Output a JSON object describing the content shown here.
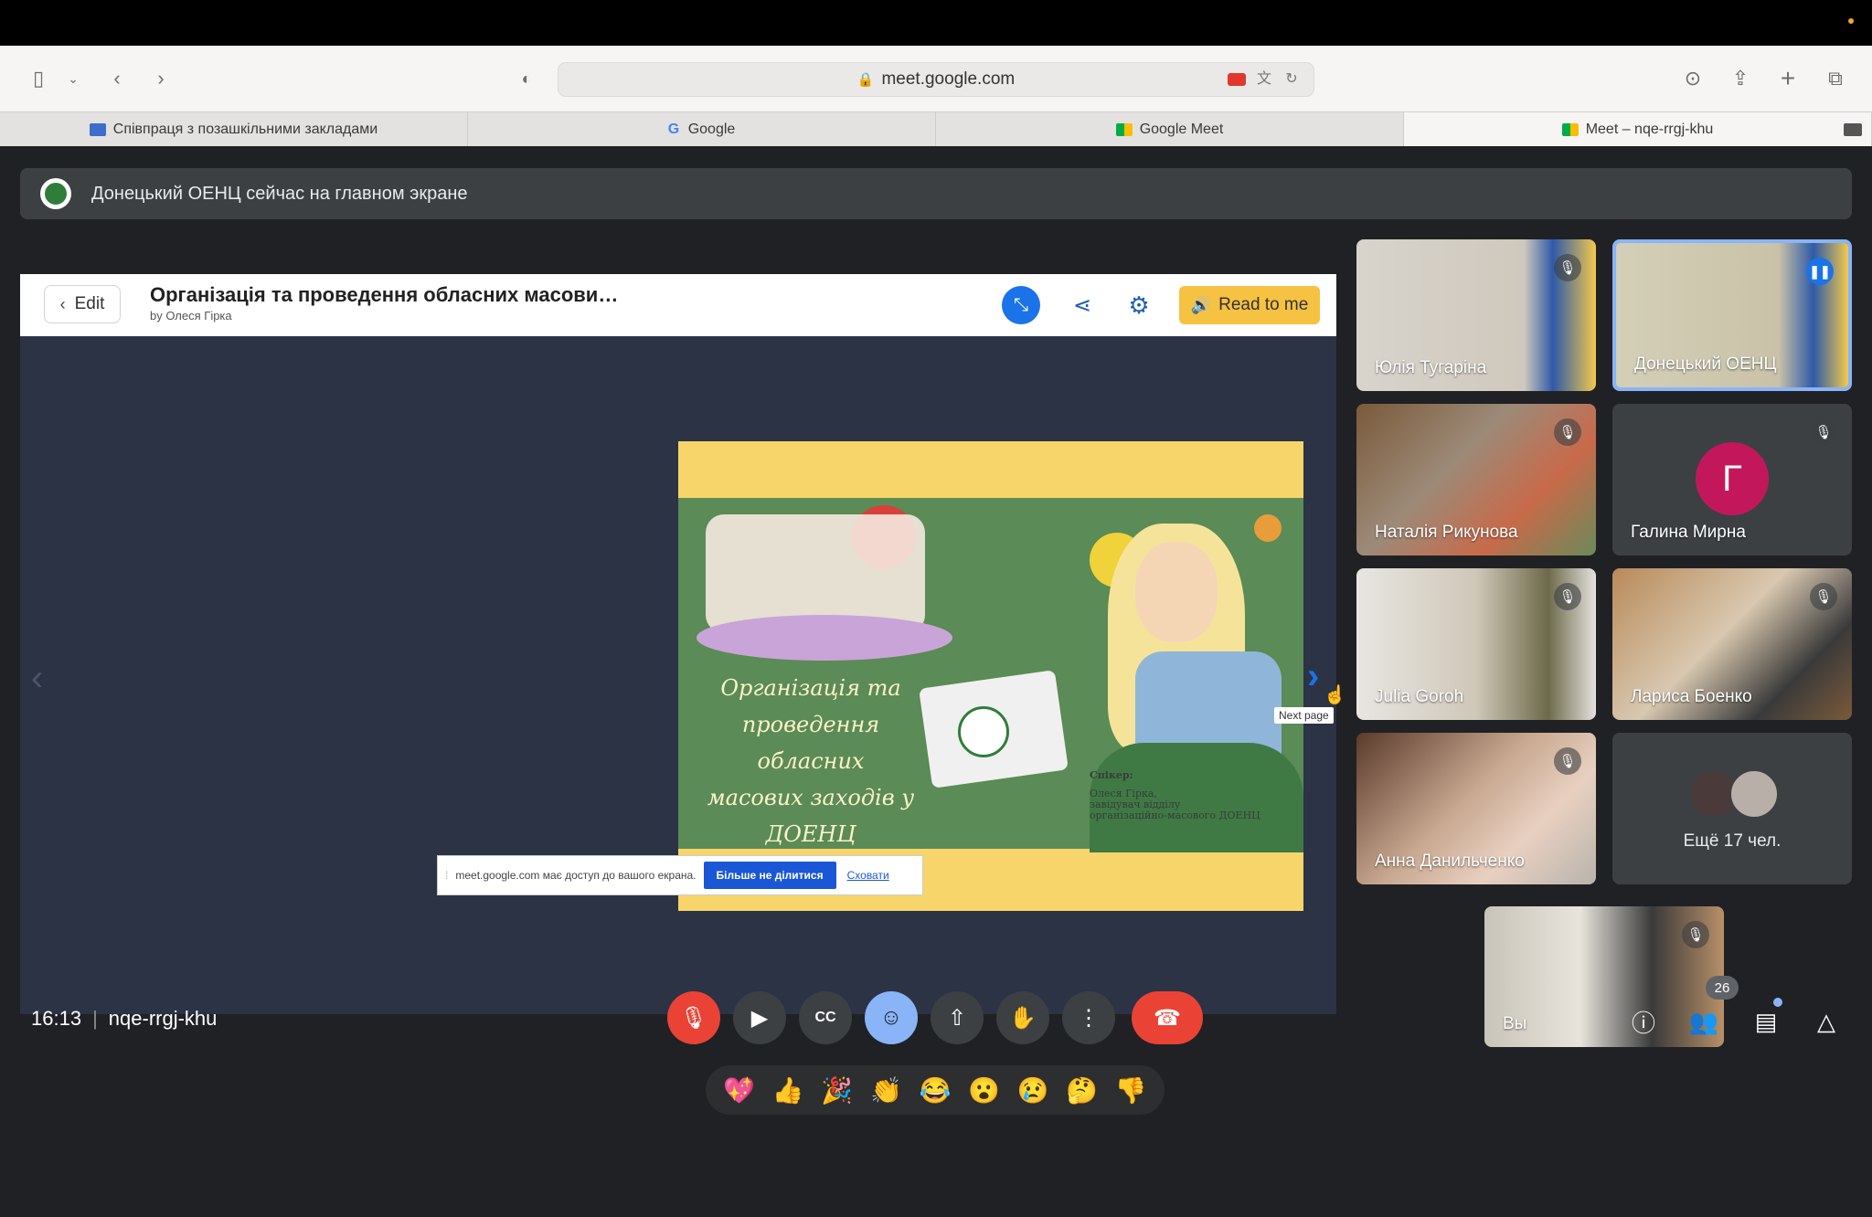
{
  "browser": {
    "url": "meet.google.com",
    "tabs": [
      {
        "label": "Співпраця з позашкільними закладами"
      },
      {
        "label": "Google"
      },
      {
        "label": "Google Meet"
      },
      {
        "label": "Meet – nqe-rrgj-khu"
      }
    ]
  },
  "banner": {
    "text": "Донецький ОЕНЦ сейчас на главном экране"
  },
  "presentation": {
    "edit_label": "Edit",
    "title": "Організація та проведення обласних масови…",
    "author": "by Олеся Гірка",
    "read_label": "Read to me",
    "next_tooltip": "Next page",
    "slide": {
      "title_lines": [
        "Організація та",
        "проведення обласних",
        "масових заходів у",
        "ДОЕНЦ"
      ],
      "speaker_label": "Спікер:",
      "speaker_lines": [
        "Олеся Гірка,",
        "завідувач відділу",
        "організаційно-масового ДОЕНЦ"
      ]
    }
  },
  "share_bar": {
    "text": "meet.google.com має доступ до вашого екрана.",
    "stop_label": "Більше не ділитися",
    "hide_label": "Сховати"
  },
  "participants": [
    {
      "name": "Юлія Тугаріна"
    },
    {
      "name": "Донецький ОЕНЦ"
    },
    {
      "name": "Наталія Рикунова"
    },
    {
      "name": "Галина Мирна",
      "initial": "Г"
    },
    {
      "name": "Julia Goroh"
    },
    {
      "name": "Лариса Боенко"
    },
    {
      "name": "Анна Данильченко"
    },
    {
      "more": "Ещё 17 чел."
    }
  ],
  "self_tile": {
    "name": "Вы"
  },
  "reactions": [
    "💖",
    "👍",
    "🎉",
    "👏",
    "😂",
    "😮",
    "😢",
    "🤔",
    "👎"
  ],
  "meeting": {
    "time": "16:13",
    "code": "nqe-rrgj-khu",
    "participant_count": "26"
  },
  "colors": {
    "accent": "#1a73e8",
    "danger": "#ea4335",
    "surface": "#3c4043",
    "background": "#202124"
  }
}
